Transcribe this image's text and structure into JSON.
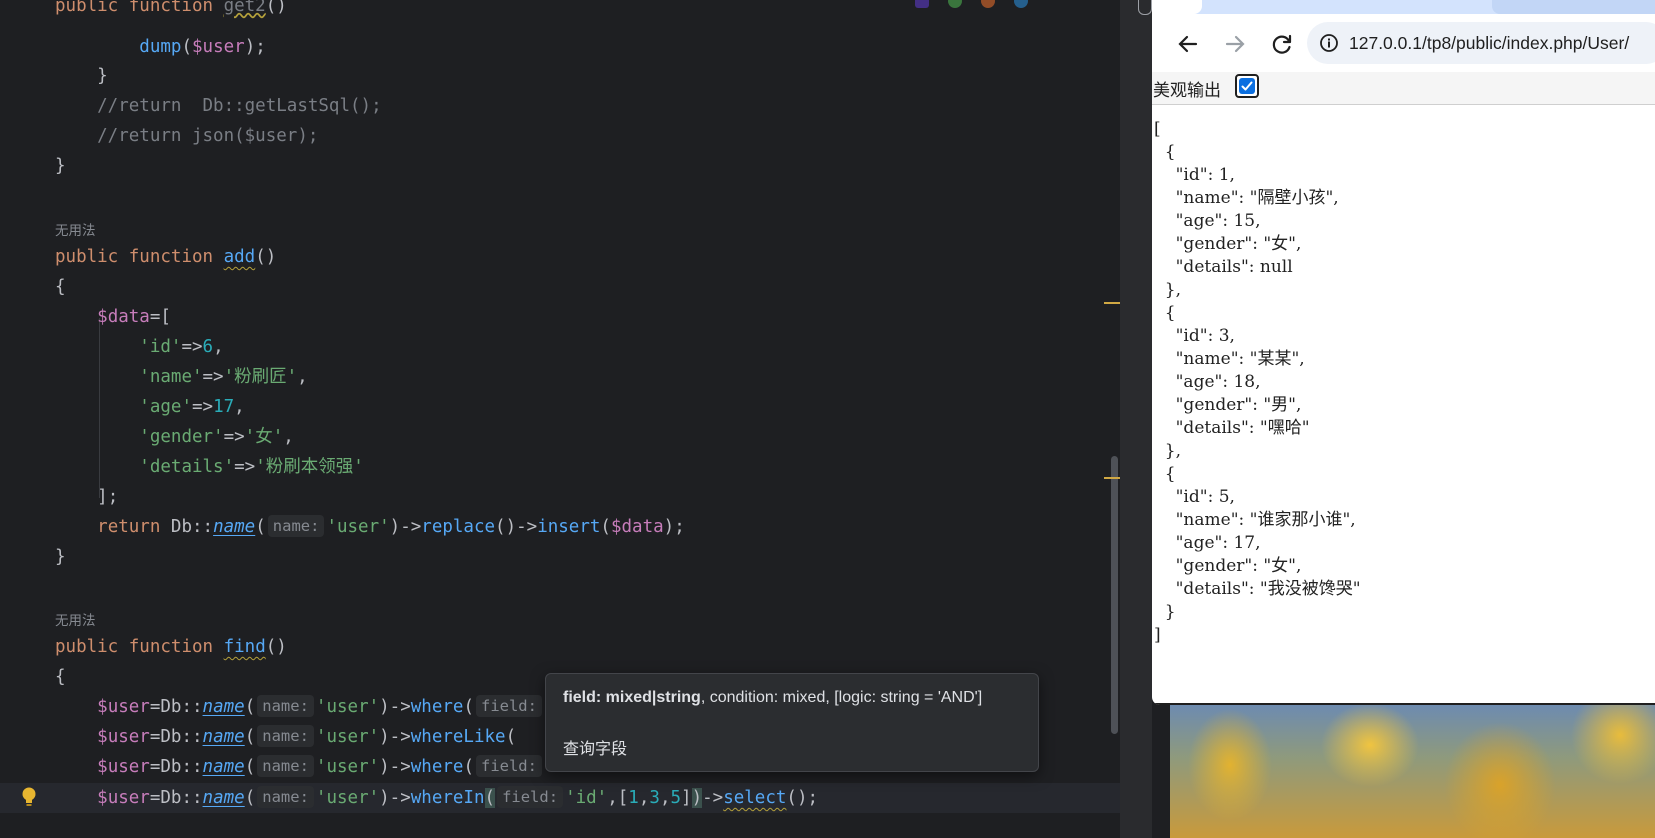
{
  "editor": {
    "lines": [
      {
        "id": "l0",
        "parts": [
          [
            "kw",
            "public "
          ],
          [
            "kw",
            "function "
          ],
          [
            "cmt",
            "get2"
          ],
          [
            "p",
            "()"
          ]
        ]
      },
      {
        "id": "l1",
        "parts": [
          [
            "p",
            "        dump("
          ],
          [
            "var",
            "$user"
          ],
          [
            "p",
            ");"
          ]
        ],
        "fix_fn": "dump"
      },
      {
        "id": "l2",
        "parts": [
          [
            "p",
            "    }"
          ]
        ]
      },
      {
        "id": "l3",
        "parts": [
          [
            "cmt",
            "    //return  Db::getLastSql();"
          ]
        ]
      },
      {
        "id": "l4",
        "parts": [
          [
            "cmt",
            "    //return json($user);"
          ]
        ]
      },
      {
        "id": "l5",
        "parts": [
          [
            "p",
            "}"
          ]
        ]
      }
    ],
    "usage_1": "无用法",
    "add_signature": {
      "public": "public",
      "function": "function",
      "name": "add",
      "parens": "()"
    },
    "brace_open": "{",
    "brace_close": "}",
    "data_var": "$data",
    "data_open": "=[",
    "data_rows": [
      {
        "key": "'id'",
        "arrow": "=>",
        "value": "6",
        "value_type": "num"
      },
      {
        "key": "'name'",
        "arrow": "=>",
        "value": "'粉刷匠'",
        "value_type": "str"
      },
      {
        "key": "'age'",
        "arrow": "=>",
        "value": "17",
        "value_type": "num"
      },
      {
        "key": "'gender'",
        "arrow": "=>",
        "value": "'女'",
        "value_type": "str"
      },
      {
        "key": "'details'",
        "arrow": "=>",
        "value": "'粉刷本领强'",
        "value_type": "str"
      }
    ],
    "data_close": "];",
    "return_kw": "return",
    "db": "Db::",
    "name_fn": "name",
    "hint_name": "name:",
    "user_str": "'user'",
    "replace_fn": "replace",
    "insert_fn": "insert",
    "usage_2": "无用法",
    "find_signature": {
      "name": "find",
      "parens": "()"
    },
    "user_var": "$user",
    "where_fn": "where",
    "wherelike_fn": "whereLike",
    "wherein_fn": "whereIn",
    "hint_field": "field:",
    "id_str": "'id'",
    "array_nums": [
      "1",
      "3",
      "5"
    ],
    "select_fn": "select"
  },
  "tooltip": {
    "signature_bold": "field: mixed|string",
    "signature_rest": ", condition: mixed, [logic: string = 'AND']",
    "doc": "查询字段"
  },
  "browser": {
    "url": "127.0.0.1/tp8/public/index.php/User/",
    "pretty_label": "美观输出",
    "pretty_checked": true,
    "json_text": "[\n  {\n    \"id\": 1,\n    \"name\": \"隔壁小孩\",\n    \"age\": 15,\n    \"gender\": \"女\",\n    \"details\": null\n  },\n  {\n    \"id\": 3,\n    \"name\": \"某某\",\n    \"age\": 18,\n    \"gender\": \"男\",\n    \"details\": \"嘿哈\"\n  },\n  {\n    \"id\": 5,\n    \"name\": \"谁家那小谁\",\n    \"age\": 17,\n    \"gender\": \"女\",\n    \"details\": \"我没被馋哭\"\n  }\n]"
  },
  "colors": {
    "editor_bg": "#1e1f22",
    "keyword": "#cf8e6d",
    "function": "#56a8f5",
    "string": "#6aab73",
    "number": "#2aacb8",
    "variable": "#c77dbb",
    "comment": "#7a7e85",
    "checkbox_accent": "#0b6fe0"
  }
}
